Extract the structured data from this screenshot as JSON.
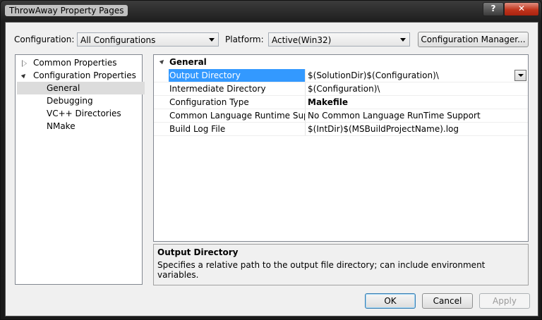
{
  "window": {
    "title": "ThrowAway Property Pages",
    "help_glyph": "?",
    "close_glyph": "✕"
  },
  "toolbar": {
    "configuration_label": "Configuration:",
    "configuration_value": "All Configurations",
    "platform_label": "Platform:",
    "platform_value": "Active(Win32)",
    "config_manager_label": "Configuration Manager..."
  },
  "tree": {
    "items": [
      {
        "label": "Common Properties",
        "expander": "collapsed",
        "level": 0
      },
      {
        "label": "Configuration Properties",
        "expander": "expanded",
        "level": 0
      },
      {
        "label": "General",
        "selected": true,
        "level": 1
      },
      {
        "label": "Debugging",
        "level": 1
      },
      {
        "label": "VC++ Directories",
        "level": 1
      },
      {
        "label": "NMake",
        "level": 1
      }
    ]
  },
  "grid": {
    "category": "General",
    "rows": [
      {
        "name": "Output Directory",
        "value": "$(SolutionDir)$(Configuration)\\",
        "selected": true
      },
      {
        "name": "Intermediate Directory",
        "value": "$(Configuration)\\"
      },
      {
        "name": "Configuration Type",
        "value": "Makefile",
        "bold": true
      },
      {
        "name": "Common Language Runtime Suppo",
        "value": "No Common Language RunTime Support"
      },
      {
        "name": "Build Log File",
        "value": "$(IntDir)$(MSBuildProjectName).log"
      }
    ]
  },
  "description": {
    "title": "Output Directory",
    "text": "Specifies a relative path to the output file directory; can include environment variables."
  },
  "buttons": {
    "ok": "OK",
    "cancel": "Cancel",
    "apply": "Apply"
  },
  "colors": {
    "selection": "#3399ff",
    "tree_selection": "#dcdcdc",
    "close_button": "#c0341c"
  }
}
